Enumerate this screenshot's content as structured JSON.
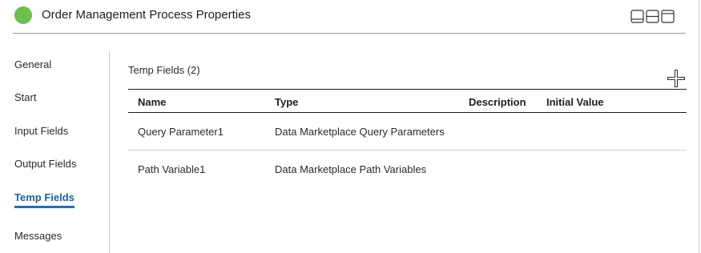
{
  "header": {
    "title": "Order Management Process Properties",
    "status_color": "#6cc04a",
    "layout_icons": [
      "layout-bottom-panel-icon",
      "layout-split-horizontal-icon",
      "layout-top-panel-icon"
    ]
  },
  "sidebar": {
    "items": [
      {
        "label": "General",
        "active": false
      },
      {
        "label": "Start",
        "active": false
      },
      {
        "label": "Input Fields",
        "active": false
      },
      {
        "label": "Output Fields",
        "active": false
      },
      {
        "label": "Temp Fields",
        "active": true
      },
      {
        "label": "Messages",
        "active": false
      }
    ],
    "active_color": "#1a6fc4"
  },
  "main": {
    "section_title": "Temp Fields (2)",
    "add_icon": "plus-icon",
    "table": {
      "columns": [
        "Name",
        "Type",
        "Description",
        "Initial Value"
      ],
      "rows": [
        {
          "name": "Query Parameter1",
          "type": "Data Marketplace Query Parameters",
          "description": "",
          "initial_value": ""
        },
        {
          "name": "Path Variable1",
          "type": "Data Marketplace Path Variables",
          "description": "",
          "initial_value": ""
        }
      ]
    }
  }
}
